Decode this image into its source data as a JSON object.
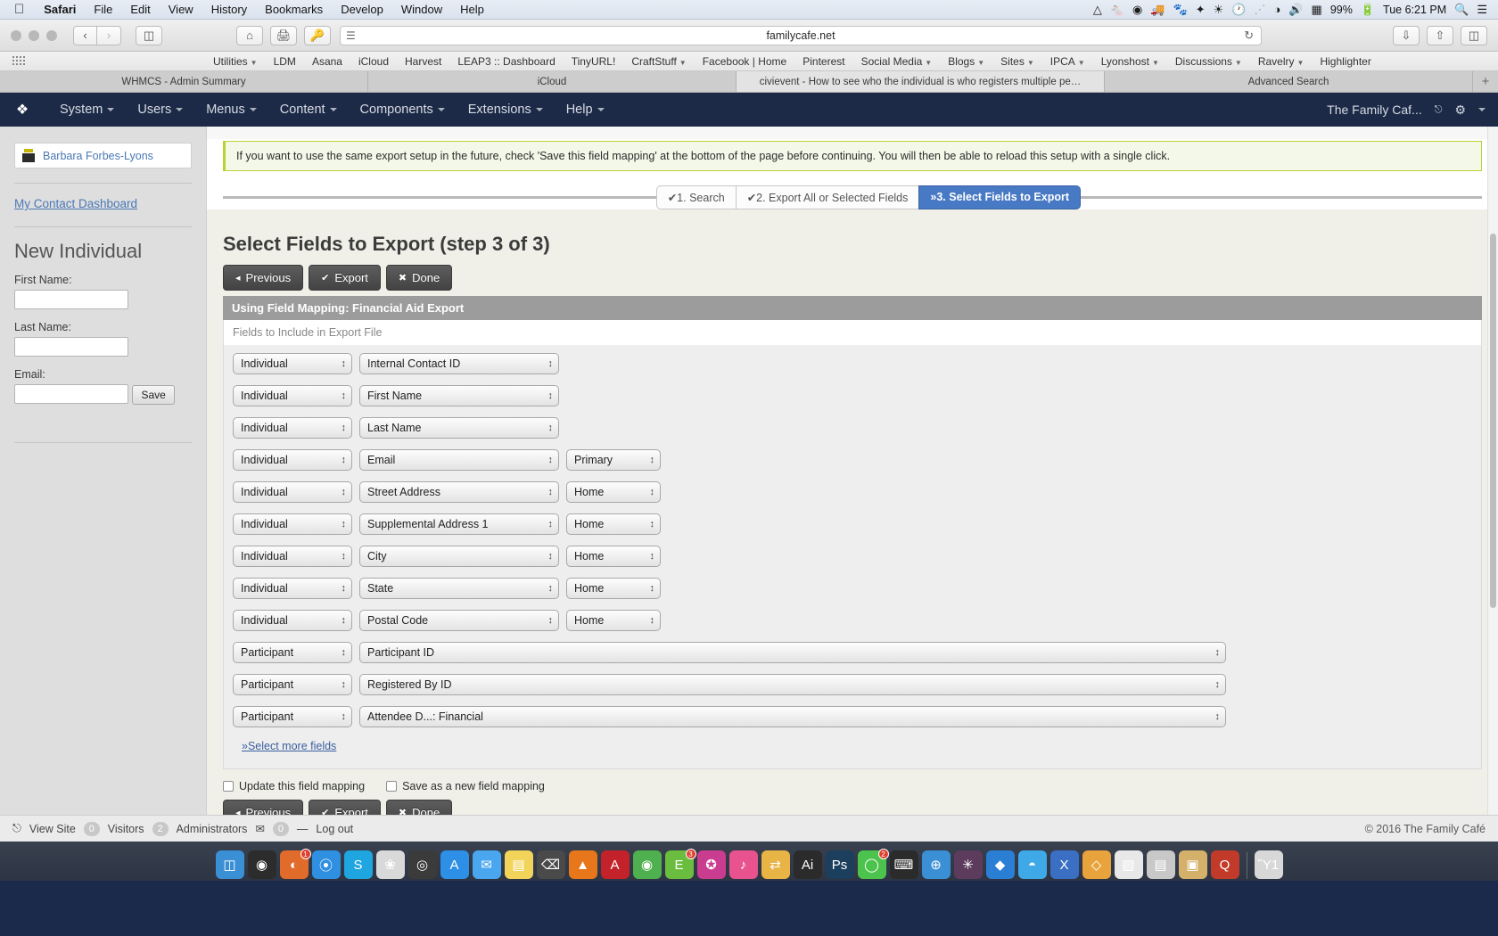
{
  "os_menu": {
    "apple_icon": "apple-logo",
    "items": [
      {
        "label": "Safari",
        "bold": true
      },
      {
        "label": "File",
        "bold": false
      },
      {
        "label": "Edit",
        "bold": false
      },
      {
        "label": "View",
        "bold": false
      },
      {
        "label": "History",
        "bold": false
      },
      {
        "label": "Bookmarks",
        "bold": false
      },
      {
        "label": "Develop",
        "bold": false
      },
      {
        "label": "Window",
        "bold": false
      },
      {
        "label": "Help",
        "bold": false
      }
    ],
    "status_icons": [
      "google-drive-icon",
      "evernote-icon",
      "creative-cloud-icon",
      "truck-icon",
      "backblaze-icon",
      "dropbox-icon",
      "flux-icon",
      "time-machine-icon",
      "bluetooth-icon",
      "wifi-icon",
      "volume-icon",
      "calculator-icon"
    ],
    "battery_percent": "99%",
    "battery_icon": "battery-charging-icon",
    "clock": "Tue 6:21 PM",
    "search_icon": "spotlight-search-icon",
    "notification_icon": "notification-center-icon"
  },
  "browser": {
    "url": "familycafe.net",
    "nav_back_icon": "chevron-left-icon",
    "nav_forward_icon": "chevron-right-icon",
    "sidebar_icon": "sidebar-toggle-icon",
    "home_icon": "home-icon",
    "print_icon": "print-icon",
    "key_icon": "key-icon",
    "reader_icon": "reader-view-icon",
    "reload_icon": "reload-icon",
    "download_icon": "download-icon",
    "share_icon": "share-icon",
    "tabs_overview_icon": "tabs-overview-icon",
    "bookmarks": [
      {
        "label": "Utilities",
        "dropdown": true
      },
      {
        "label": "LDM",
        "dropdown": false
      },
      {
        "label": "Asana",
        "dropdown": false
      },
      {
        "label": "iCloud",
        "dropdown": false
      },
      {
        "label": "Harvest",
        "dropdown": false
      },
      {
        "label": "LEAP3 :: Dashboard",
        "dropdown": false
      },
      {
        "label": "TinyURL!",
        "dropdown": false
      },
      {
        "label": "CraftStuff",
        "dropdown": true
      },
      {
        "label": "Facebook | Home",
        "dropdown": false
      },
      {
        "label": "Pinterest",
        "dropdown": false
      },
      {
        "label": "Social Media",
        "dropdown": true
      },
      {
        "label": "Blogs",
        "dropdown": true
      },
      {
        "label": "Sites",
        "dropdown": true
      },
      {
        "label": "IPCA",
        "dropdown": true
      },
      {
        "label": "Lyonshost",
        "dropdown": true
      },
      {
        "label": "Discussions",
        "dropdown": true
      },
      {
        "label": "Ravelry",
        "dropdown": true
      },
      {
        "label": "Highlighter",
        "dropdown": false
      }
    ],
    "tabs": [
      {
        "title": "WHMCS - Admin Summary",
        "active": false
      },
      {
        "title": "iCloud",
        "active": false
      },
      {
        "title": "civievent - How to see who the individual is who registers multiple pe…",
        "active": true
      },
      {
        "title": "Advanced Search",
        "active": false
      }
    ],
    "new_tab_label": "+"
  },
  "admin_bar": {
    "logo_icon": "joomla-logo-icon",
    "menus": [
      {
        "label": "System"
      },
      {
        "label": "Users"
      },
      {
        "label": "Menus"
      },
      {
        "label": "Content"
      },
      {
        "label": "Components"
      },
      {
        "label": "Extensions"
      },
      {
        "label": "Help"
      }
    ],
    "site_name": "The Family Caf...",
    "external_icon": "external-link-icon",
    "settings_icon": "gear-icon"
  },
  "sidebar": {
    "contact_name": "Barbara Forbes-Lyons",
    "contact_icon": "contact-avatar-icon",
    "dashboard_link": "My Contact Dashboard",
    "new_individual_title": "New Individual",
    "fields": [
      {
        "label": "First Name:",
        "value": "",
        "name": "first-name-field"
      },
      {
        "label": "Last Name:",
        "value": "",
        "name": "last-name-field"
      },
      {
        "label": "Email:",
        "value": "",
        "name": "email-field"
      }
    ],
    "save_label": "Save"
  },
  "main": {
    "notice": "If you want to use the same export setup in the future, check 'Save this field mapping' at the bottom of the page before continuing. You will then be able to reload this setup with a single click.",
    "wizard_steps": [
      {
        "label": "✔1. Search",
        "active": false
      },
      {
        "label": "✔2. Export All or Selected Fields",
        "active": false
      },
      {
        "label": "»3. Select Fields to Export",
        "active": true
      }
    ],
    "page_title": "Select Fields to Export (step 3 of 3)",
    "buttons": [
      {
        "icon": "◂",
        "label": "Previous",
        "name": "previous-button"
      },
      {
        "icon": "✔",
        "label": "Export",
        "name": "export-button"
      },
      {
        "icon": "✖",
        "label": "Done",
        "name": "done-button"
      }
    ],
    "mapping_bar": "Using Field Mapping: Financial Aid Export",
    "fields_header": "Fields to Include in Export File",
    "field_rows": [
      {
        "entity": "Individual",
        "field": "Internal Contact ID",
        "location": null,
        "wide": false
      },
      {
        "entity": "Individual",
        "field": "First Name",
        "location": null,
        "wide": false
      },
      {
        "entity": "Individual",
        "field": "Last Name",
        "location": null,
        "wide": false
      },
      {
        "entity": "Individual",
        "field": "Email",
        "location": "Primary",
        "wide": false
      },
      {
        "entity": "Individual",
        "field": "Street Address",
        "location": "Home",
        "wide": false
      },
      {
        "entity": "Individual",
        "field": "Supplemental Address 1",
        "location": "Home",
        "wide": false
      },
      {
        "entity": "Individual",
        "field": "City",
        "location": "Home",
        "wide": false
      },
      {
        "entity": "Individual",
        "field": "State",
        "location": "Home",
        "wide": false
      },
      {
        "entity": "Individual",
        "field": "Postal Code",
        "location": "Home",
        "wide": false
      },
      {
        "entity": "Participant",
        "field": "Participant ID",
        "location": null,
        "wide": true
      },
      {
        "entity": "Participant",
        "field": "Registered By ID",
        "location": null,
        "wide": true
      },
      {
        "entity": "Participant",
        "field": "Attendee D...: Financial",
        "location": null,
        "wide": true
      }
    ],
    "select_more_link": "»Select more fields",
    "checkboxes": [
      {
        "label": "Update this field mapping",
        "checked": false,
        "name": "update-field-mapping-checkbox"
      },
      {
        "label": "Save as a new field mapping",
        "checked": false,
        "name": "save-new-field-mapping-checkbox"
      }
    ],
    "bottom_buttons": [
      {
        "icon": "◂",
        "label": "Previous",
        "name": "previous-button-bottom"
      },
      {
        "icon": "✔",
        "label": "Export",
        "name": "export-button-bottom"
      },
      {
        "icon": "✖",
        "label": "Done",
        "name": "done-button-bottom"
      }
    ]
  },
  "status_bar": {
    "view_site": "View Site",
    "view_site_icon": "external-link-icon",
    "visitors_count": "0",
    "visitors_label": "Visitors",
    "admins_count": "2",
    "admins_label": "Administrators",
    "mail_icon": "envelope-icon",
    "messages_count": "0",
    "dash": "—",
    "logout": "Log out",
    "copyright": "© 2016 The Family Café"
  },
  "dock": {
    "icons": [
      {
        "name": "finder-icon",
        "glyph": "◫",
        "color": "#3b8fd4",
        "badge": null
      },
      {
        "name": "launchpad-icon",
        "glyph": "◉",
        "color": "#2c2c2c",
        "badge": null
      },
      {
        "name": "firefox-icon",
        "glyph": "◐",
        "color": "#e06b2a",
        "badge": "1"
      },
      {
        "name": "safari-icon",
        "glyph": "⦿",
        "color": "#2f8fe0",
        "badge": null
      },
      {
        "name": "skype-icon",
        "glyph": "S",
        "color": "#1fa5e0",
        "badge": null
      },
      {
        "name": "photos-icon",
        "glyph": "❀",
        "color": "#d9d9d9",
        "badge": null
      },
      {
        "name": "disc-icon",
        "glyph": "◎",
        "color": "#3b3b3b",
        "badge": null
      },
      {
        "name": "appstore-icon",
        "glyph": "A",
        "color": "#2e8fe6",
        "badge": null
      },
      {
        "name": "mail-icon",
        "glyph": "✉",
        "color": "#49a6ef",
        "badge": null
      },
      {
        "name": "notes-icon",
        "glyph": "▤",
        "color": "#f2d45a",
        "badge": null
      },
      {
        "name": "terminal-icon",
        "glyph": "⌫",
        "color": "#4a4a4a",
        "badge": null
      },
      {
        "name": "vlc-icon",
        "glyph": "▲",
        "color": "#e8761a",
        "badge": null
      },
      {
        "name": "acrobat-icon",
        "glyph": "A",
        "color": "#c3222a",
        "badge": null
      },
      {
        "name": "chrome-icon",
        "glyph": "◉",
        "color": "#4fb04f",
        "badge": null
      },
      {
        "name": "evernote-icon",
        "glyph": "Ε",
        "color": "#6bbd3f",
        "badge": "3"
      },
      {
        "name": "coda-icon",
        "glyph": "✪",
        "color": "#c93c8f",
        "badge": null
      },
      {
        "name": "itunes-icon",
        "glyph": "♪",
        "color": "#e8528f",
        "badge": null
      },
      {
        "name": "transmit-icon",
        "glyph": "⇄",
        "color": "#e8b445",
        "badge": null
      },
      {
        "name": "illustrator-icon",
        "glyph": "Ai",
        "color": "#2b2b2b",
        "badge": null
      },
      {
        "name": "photoshop-icon",
        "glyph": "Ps",
        "color": "#1c3f5e",
        "badge": null
      },
      {
        "name": "messages-icon",
        "glyph": "◯",
        "color": "#4cc34c",
        "badge": "2"
      },
      {
        "name": "textexpander-icon",
        "glyph": "⌨",
        "color": "#2b2b2b",
        "badge": null
      },
      {
        "name": "internet-icon",
        "glyph": "⊕",
        "color": "#3b8fd4",
        "badge": null
      },
      {
        "name": "slack-icon",
        "glyph": "✳",
        "color": "#5d3b5d",
        "badge": null
      },
      {
        "name": "dropbox-icon",
        "glyph": "◆",
        "color": "#2a7fd4",
        "badge": null
      },
      {
        "name": "twitter-icon",
        "glyph": "◓",
        "color": "#3fa9e8",
        "badge": null
      },
      {
        "name": "x-icon",
        "glyph": "X",
        "color": "#3b6fc4",
        "badge": null
      },
      {
        "name": "sketch-icon",
        "glyph": "◇",
        "color": "#e8a33c",
        "badge": null
      },
      {
        "name": "pages-icon",
        "glyph": "▧",
        "color": "#e8e8e8",
        "badge": null
      },
      {
        "name": "stacks-icon",
        "glyph": "▤",
        "color": "#c8c8c8",
        "badge": null
      },
      {
        "name": "box-icon",
        "glyph": "▣",
        "color": "#d4b06a",
        "badge": null
      },
      {
        "name": "quark-icon",
        "glyph": "Q",
        "color": "#c23a2a",
        "badge": null
      },
      {
        "name": "trash-icon",
        "glyph": "Ὕ1",
        "color": "#d8d8d8",
        "badge": null
      }
    ]
  }
}
